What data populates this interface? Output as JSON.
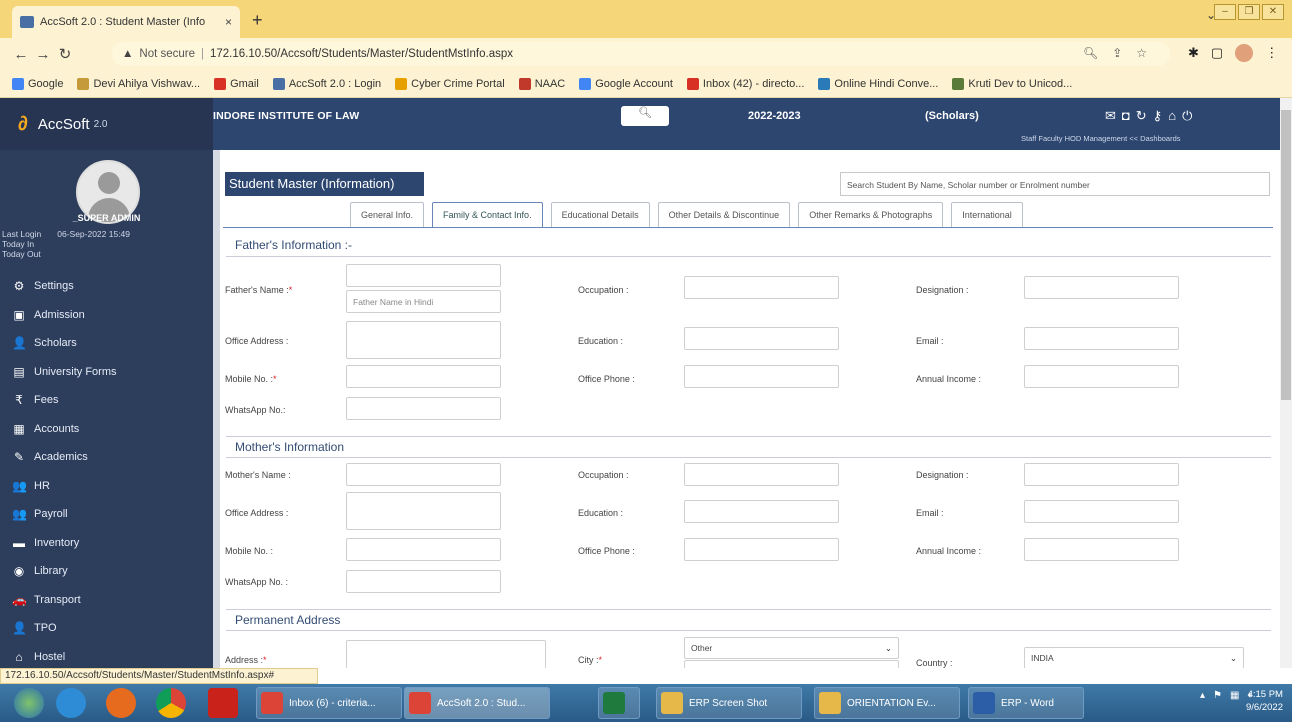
{
  "browser": {
    "tab_title": "AccSoft 2.0 : Student Master (Info",
    "tab_close": "×",
    "new_tab": "+",
    "url_warning": "Not secure",
    "url": "172.16.10.50/Accsoft/Students/Master/StudentMstInfo.aspx",
    "bookmarks": [
      {
        "label": "Google",
        "color": "#4285f4"
      },
      {
        "label": "Devi Ahilya Vishwav...",
        "color": "#c49a3a"
      },
      {
        "label": "Gmail",
        "color": "#d93025"
      },
      {
        "label": "AccSoft 2.0 : Login",
        "color": "#4a6fa5"
      },
      {
        "label": "Cyber Crime Portal",
        "color": "#e6a100"
      },
      {
        "label": "NAAC",
        "color": "#c0392b"
      },
      {
        "label": "Google Account",
        "color": "#4285f4"
      },
      {
        "label": "Inbox (42) - directo...",
        "color": "#d93025"
      },
      {
        "label": "Online Hindi Conve...",
        "color": "#2a7ab8"
      },
      {
        "label": "Kruti Dev to Unicod...",
        "color": "#5a7a3a"
      }
    ],
    "status_url": "172.16.10.50/Accsoft/Students/Master/StudentMstInfo.aspx#"
  },
  "sidebar": {
    "logo": "AccSoft",
    "version": "2.0",
    "user": "_SUPER ADMIN",
    "last_login_label": "Last Login",
    "last_login_value": "06-Sep-2022 15:49",
    "today_in": "Today In",
    "today_out": "Today Out",
    "menu": [
      {
        "label": "Settings",
        "icon": "⚙"
      },
      {
        "label": "Admission",
        "icon": "▣"
      },
      {
        "label": "Scholars",
        "icon": "👤"
      },
      {
        "label": "University Forms",
        "icon": "▤"
      },
      {
        "label": "Fees",
        "icon": "₹"
      },
      {
        "label": "Accounts",
        "icon": "▦"
      },
      {
        "label": "Academics",
        "icon": "✎"
      },
      {
        "label": "HR",
        "icon": "👥"
      },
      {
        "label": "Payroll",
        "icon": "👥"
      },
      {
        "label": "Inventory",
        "icon": "▬"
      },
      {
        "label": "Library",
        "icon": "◉"
      },
      {
        "label": "Transport",
        "icon": "🚗"
      },
      {
        "label": "TPO",
        "icon": "👤"
      },
      {
        "label": "Hostel",
        "icon": "⌂"
      }
    ]
  },
  "topbar": {
    "institute": "INDORE INSTITUTE OF LAW",
    "year": "2022-2023",
    "scholars": "(Scholars)",
    "links": "Staff   Faculty   HOD   Management << Dashboards"
  },
  "page": {
    "title": "Student Master (Information)",
    "search_placeholder": "Search Student By Name, Scholar number or Enrolment number",
    "tabs": [
      "General Info.",
      "Family & Contact Info.",
      "Educational Details",
      "Other Details & Discontinue",
      "Other Remarks & Photographs",
      "International"
    ],
    "active_tab": 1
  },
  "form": {
    "father_section": "Father's Information :-",
    "father_name": "Father's Name :",
    "father_name_hindi_placeholder": "Father Name in Hindi",
    "occupation": "Occupation :",
    "designation": "Designation :",
    "office_address": "Office Address :",
    "education": "Education :",
    "email": "Email :",
    "mobile": "Mobile No. :",
    "office_phone": "Office Phone :",
    "annual_income": "Annual Income :",
    "whatsapp": "WhatsApp No.:",
    "mother_section": "Mother's Information",
    "mother_name": "Mother's Name :",
    "m_occupation": "Occupation :",
    "m_designation": "Designation :",
    "m_office_address": "Office Address :",
    "m_education": "Education :",
    "m_email": "Email :",
    "m_mobile": "Mobile No. :",
    "m_office_phone": "Office Phone :",
    "m_annual_income": "Annual Income :",
    "m_whatsapp": "WhatsApp No. :",
    "permanent_section": "Permanent Address",
    "address": "Address :",
    "city": "City :",
    "city_value": "Other",
    "country": "Country :",
    "country_value": "INDIA",
    "required_mark": "*"
  },
  "taskbar": {
    "windows": [
      "Inbox (6) - criteria...",
      "AccSoft 2.0 : Stud...",
      "",
      "ERP Screen Shot",
      "ORIENTATION Ev...",
      "ERP - Word"
    ],
    "time": "4:15 PM",
    "date": "9/6/2022"
  }
}
